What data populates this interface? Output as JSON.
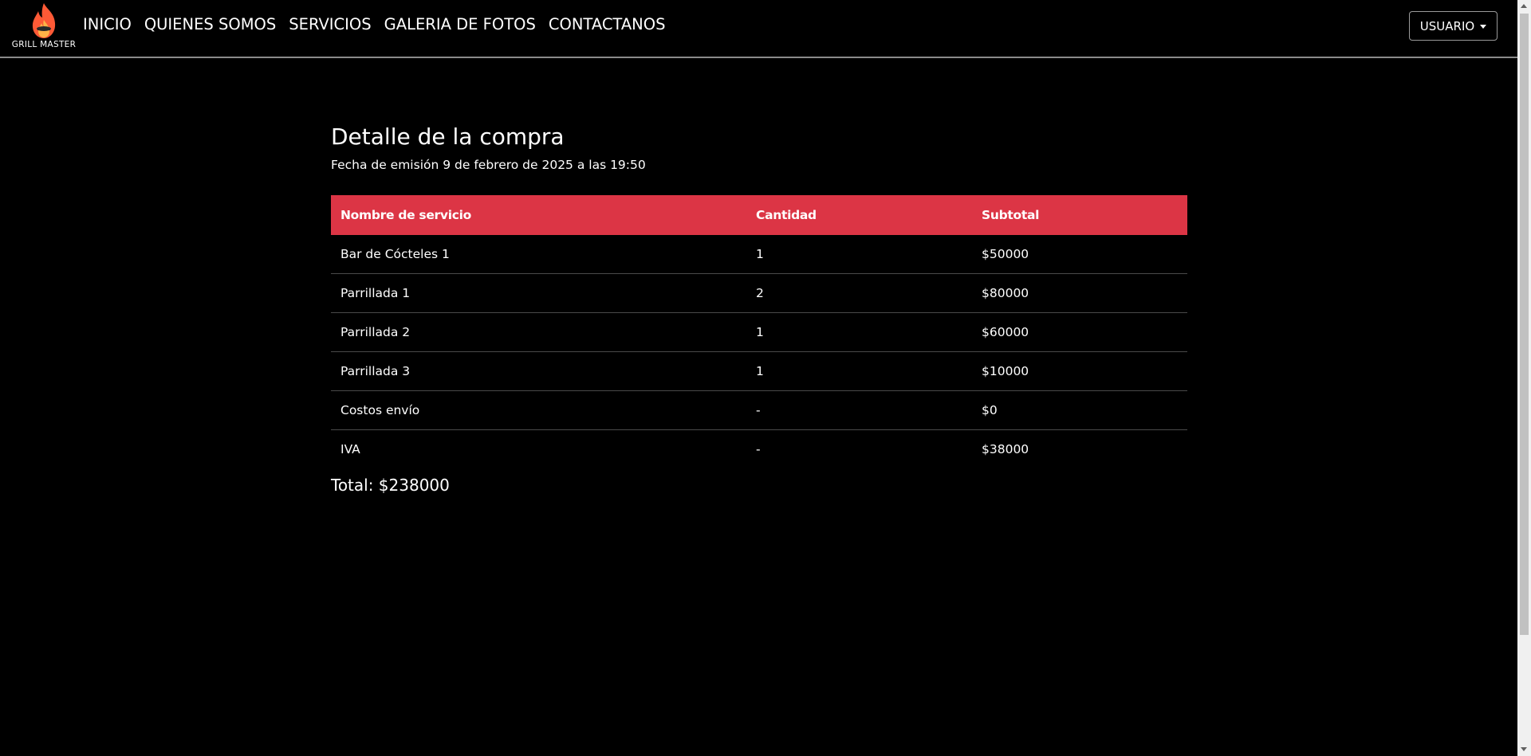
{
  "brand": {
    "name": "GRILL MASTER",
    "flame_color": "#ff5a36",
    "flame_inner_color": "#ffb347"
  },
  "nav": {
    "items": [
      {
        "label": "INICIO"
      },
      {
        "label": "QUIENES SOMOS"
      },
      {
        "label": "SERVICIOS"
      },
      {
        "label": "GALERIA DE FOTOS"
      },
      {
        "label": "CONTACTANOS"
      }
    ],
    "user_button": "USUARIO"
  },
  "main": {
    "title": "Detalle de la compra",
    "issue_date": "Fecha de emisión 9 de febrero de 2025 a las 19:50",
    "table": {
      "header_color": "#dc3545",
      "columns": [
        "Nombre de servicio",
        "Cantidad",
        "Subtotal"
      ],
      "rows": [
        [
          "Bar de Cócteles 1",
          "1",
          "$50000"
        ],
        [
          "Parrillada 1",
          "2",
          "$80000"
        ],
        [
          "Parrillada 2",
          "1",
          "$60000"
        ],
        [
          "Parrillada 3",
          "1",
          "$10000"
        ],
        [
          "Costos envío",
          "-",
          "$0"
        ],
        [
          "IVA",
          "-",
          "$38000"
        ]
      ]
    },
    "total": "Total: $238000"
  }
}
